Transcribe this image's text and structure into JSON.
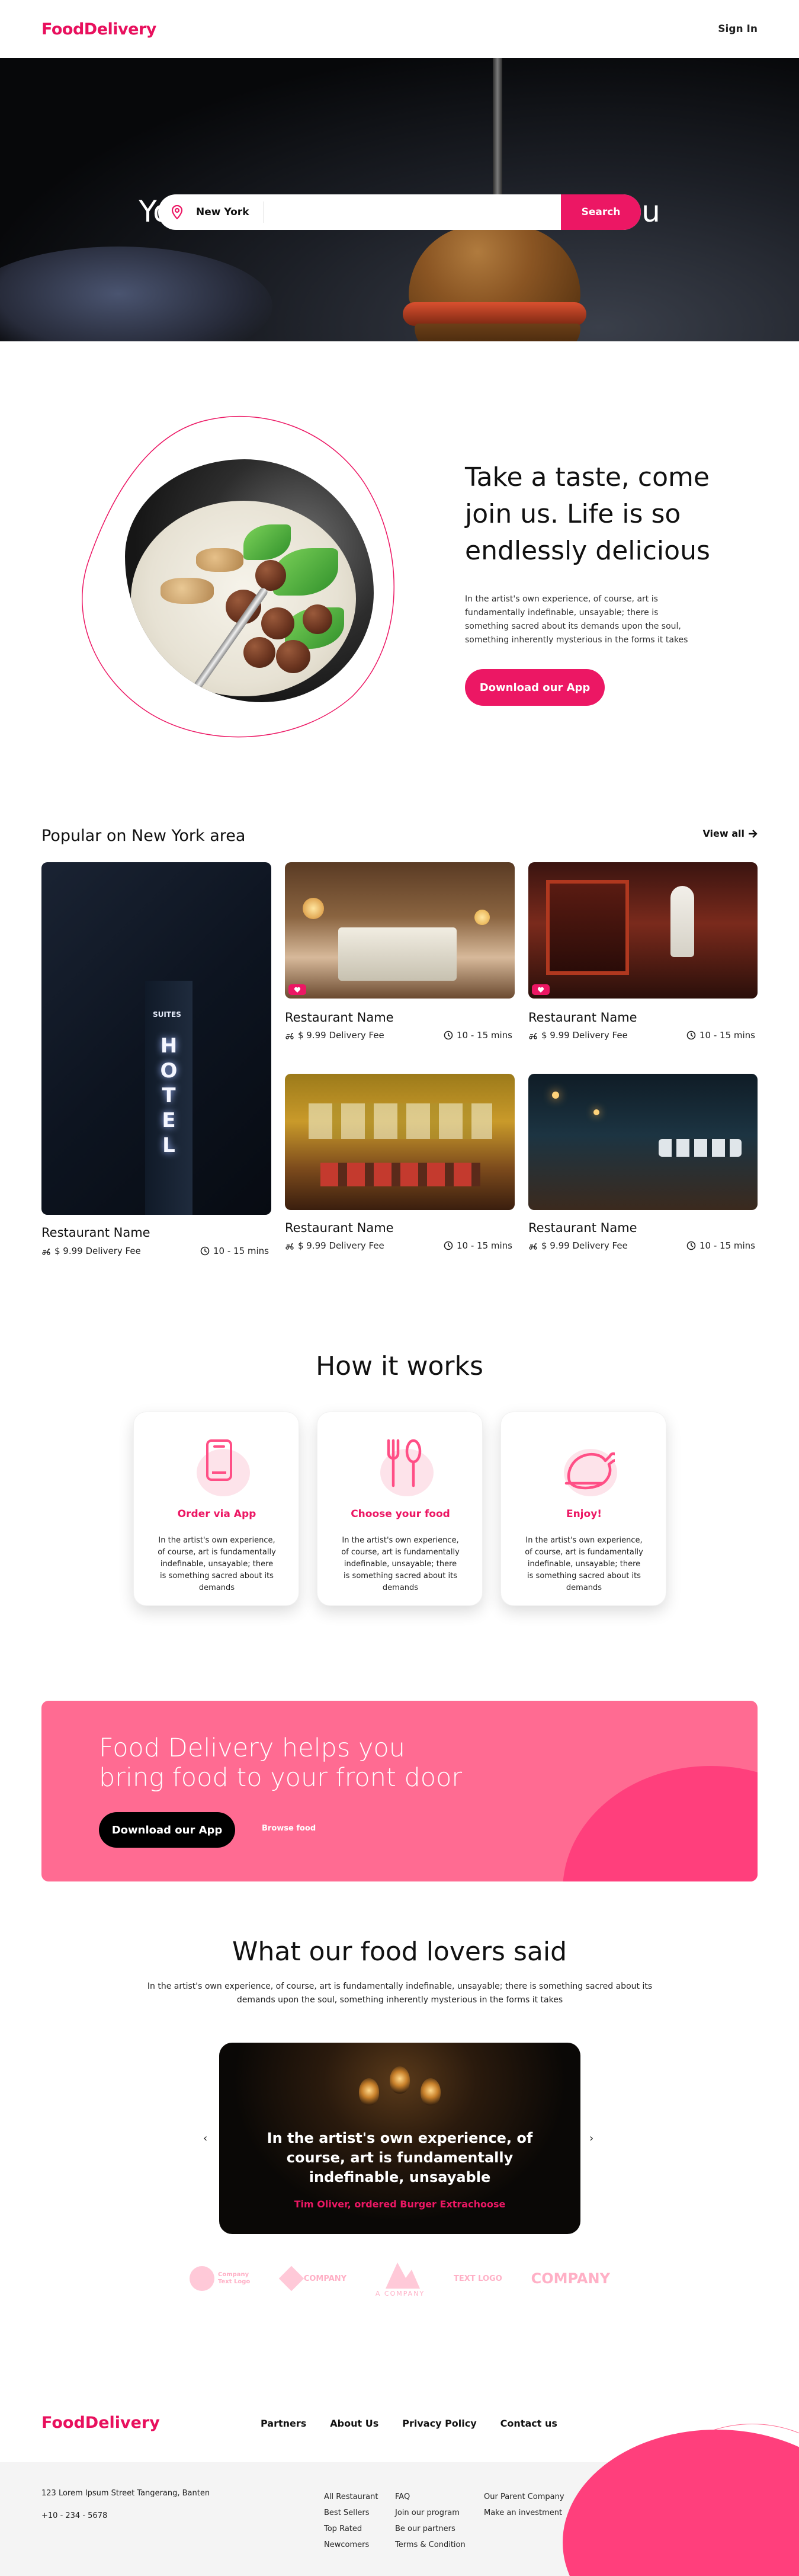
{
  "header": {
    "logo": "FoodDelivery",
    "signin": "Sign In"
  },
  "hero": {
    "title": "Your favorite food, delivered to you",
    "location": "New York",
    "search_button": "Search"
  },
  "taste": {
    "title": "Take a taste, come join us. Life is so endlessly delicious",
    "text": "In the artist's own experience, of course, art is fundamentally indefinable, unsayable; there is something sacred about its demands upon the soul, something inherently mysterious in the forms it takes",
    "button": "Download our App"
  },
  "popular": {
    "title": "Popular on New York area",
    "view_all": "View all",
    "restaurants": [
      {
        "name": "Restaurant Name",
        "fee": "$ 9.99 Delivery Fee",
        "time": "10 - 15 mins"
      },
      {
        "name": "Restaurant Name",
        "fee": "$ 9.99 Delivery Fee",
        "time": "10 - 15 mins"
      },
      {
        "name": "Restaurant Name",
        "fee": "$ 9.99 Delivery Fee",
        "time": "10 - 15 mins"
      },
      {
        "name": "Restaurant Name",
        "fee": "$ 9.99 Delivery Fee",
        "time": "10 - 15 mins"
      },
      {
        "name": "Restaurant Name",
        "fee": "$ 9.99 Delivery Fee",
        "time": "10 - 15 mins"
      }
    ],
    "hotel_sign": "HOTEL",
    "hotel_small": "SUITES"
  },
  "how": {
    "title": "How it works",
    "steps": [
      {
        "title": "Order via App",
        "text": "In the artist's own experience, of course, art is fundamentally indefinable, unsayable; there is something sacred about its demands",
        "icon": "phone-icon"
      },
      {
        "title": "Choose your food",
        "text": "In the artist's own experience, of course, art is fundamentally indefinable, unsayable; there is something sacred about its demands",
        "icon": "cutlery-icon"
      },
      {
        "title": "Enjoy!",
        "text": "In the artist's own experience, of course, art is fundamentally indefinable, unsayable; there is something sacred about its demands",
        "icon": "chicken-icon"
      }
    ]
  },
  "banner": {
    "title": "Food Delivery helps you bring food to your front door",
    "button": "Download our App",
    "link": "Browse food"
  },
  "testimonials": {
    "title": "What our food lovers said",
    "subtitle": "In the artist's own experience, of course, art is fundamentally indefinable, unsayable; there is something sacred about its demands upon the soul, something inherently mysterious in the forms it takes",
    "quote": "In the artist's own experience, of course, art is fundamentally indefinable, unsayable",
    "author": "Tim Oliver, ordered Burger Extrachoose",
    "prev": "‹",
    "next": "›"
  },
  "brands": [
    "Company Text Logo",
    "COMPANY",
    "A COMPANY",
    "TEXT LOGO",
    "COMPANY"
  ],
  "footer": {
    "logo": "FoodDelivery",
    "nav": [
      "Partners",
      "About Us",
      "Privacy Policy",
      "Contact us"
    ],
    "address": "123 Lorem Ipsum Street Tangerang, Banten",
    "phone": "+10 - 234 - 5678",
    "col1": [
      "All Restaurant",
      "Best Sellers",
      "Top Rated",
      "Newcomers"
    ],
    "col2": [
      "FAQ",
      "Join our program",
      "Be our partners",
      "Terms & Condition"
    ],
    "col3": [
      "Our Parent Company",
      "Make an investment"
    ]
  },
  "colors": {
    "accent": "#ec1764",
    "banner": "#ff6b92",
    "banner_dark": "#ff3f7c"
  }
}
